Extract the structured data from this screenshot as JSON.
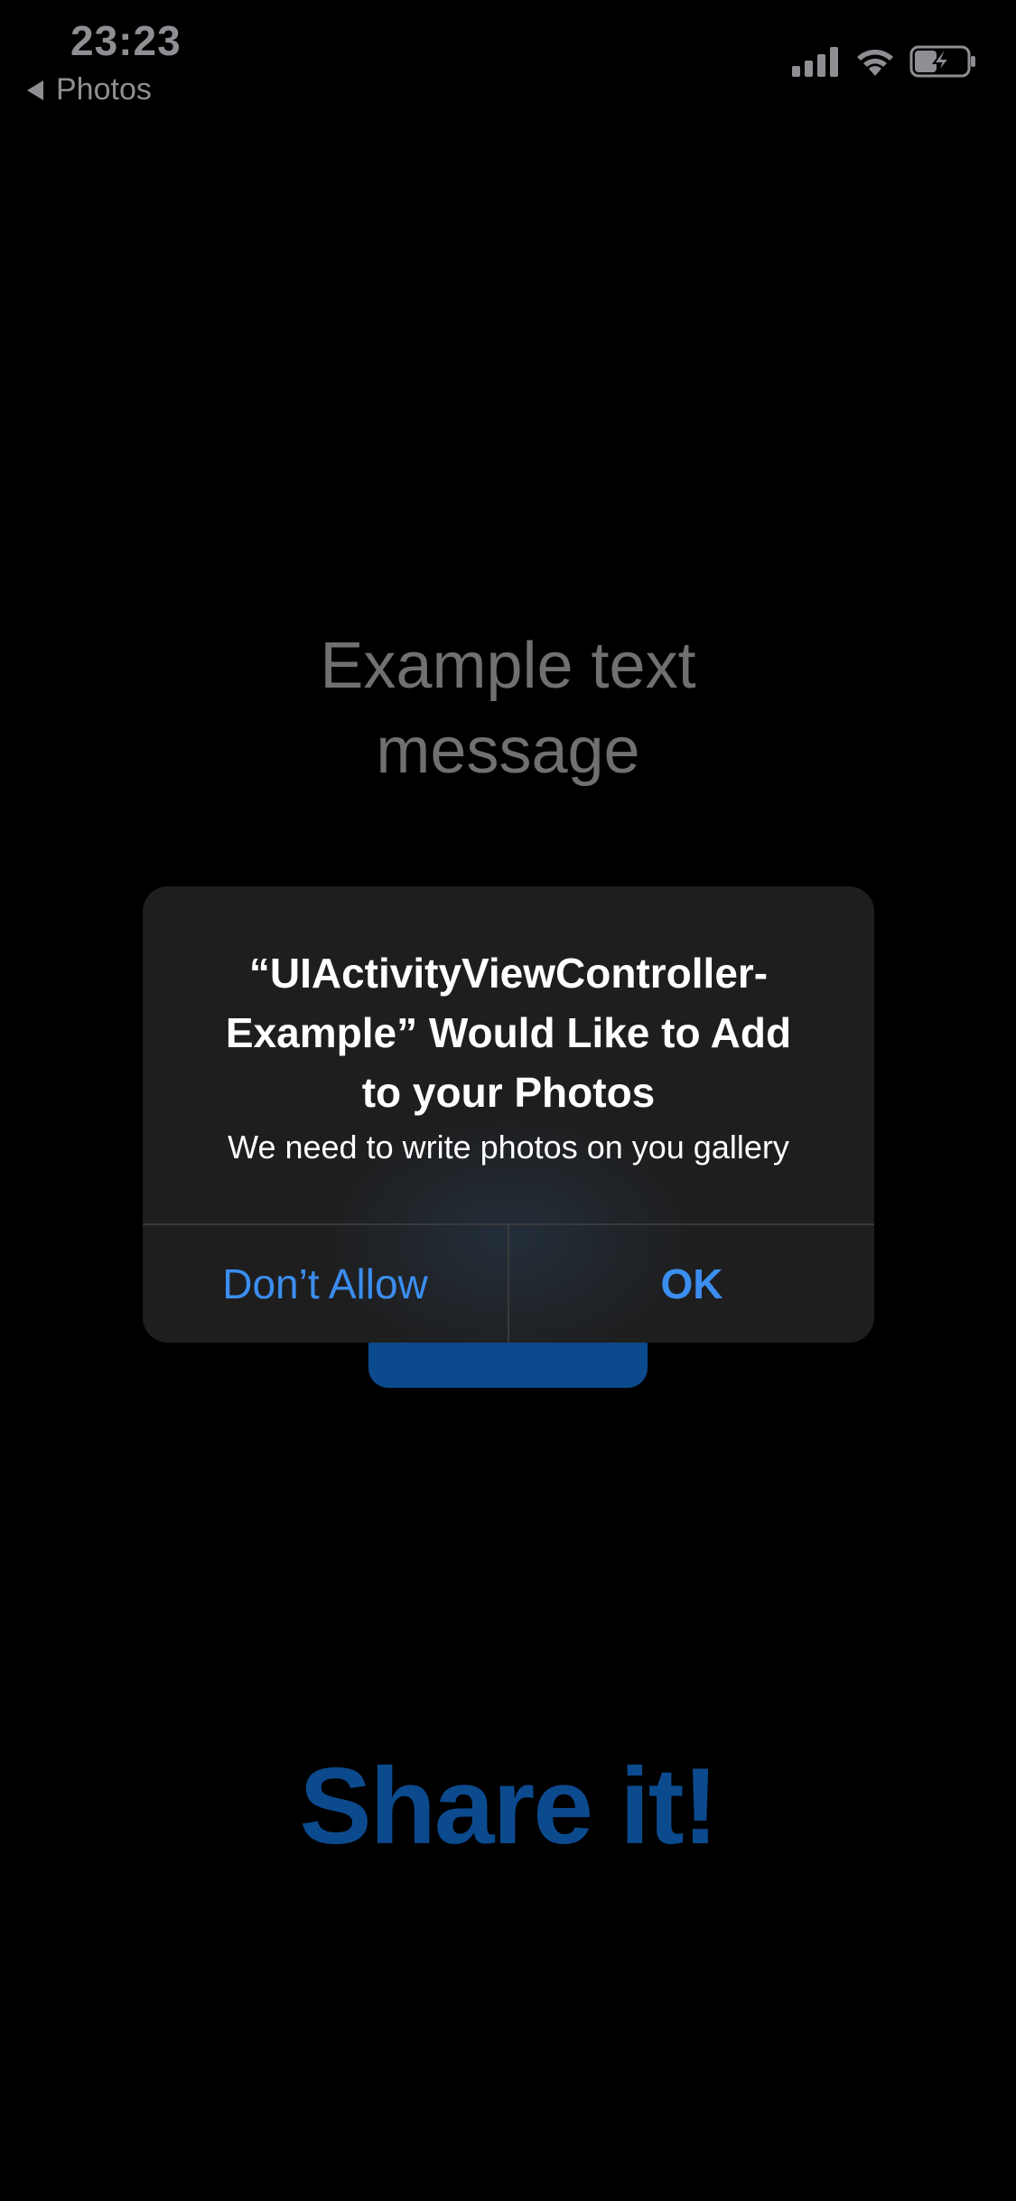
{
  "status_bar": {
    "time": "23:23",
    "back_label": "Photos",
    "icons": [
      "cellular-signal-icon",
      "wifi-icon",
      "battery-charging-icon"
    ]
  },
  "background": {
    "message_line1": "Example text",
    "message_line2": "message",
    "share_title": "Share it!"
  },
  "alert": {
    "title_line1": "“UIActivityViewController-",
    "title_line2": "Example” Would Like to Add",
    "title_line3": "to your Photos",
    "message": "We need to write photos on you gallery",
    "deny_label": "Don’t Allow",
    "ok_label": "OK"
  },
  "colors": {
    "background": "#000000",
    "alert_background": "#1e1e1f",
    "alert_button": "#3b8ef0",
    "accent_dimmed": "#0c4a8e",
    "status_text": "#8e8e93"
  }
}
